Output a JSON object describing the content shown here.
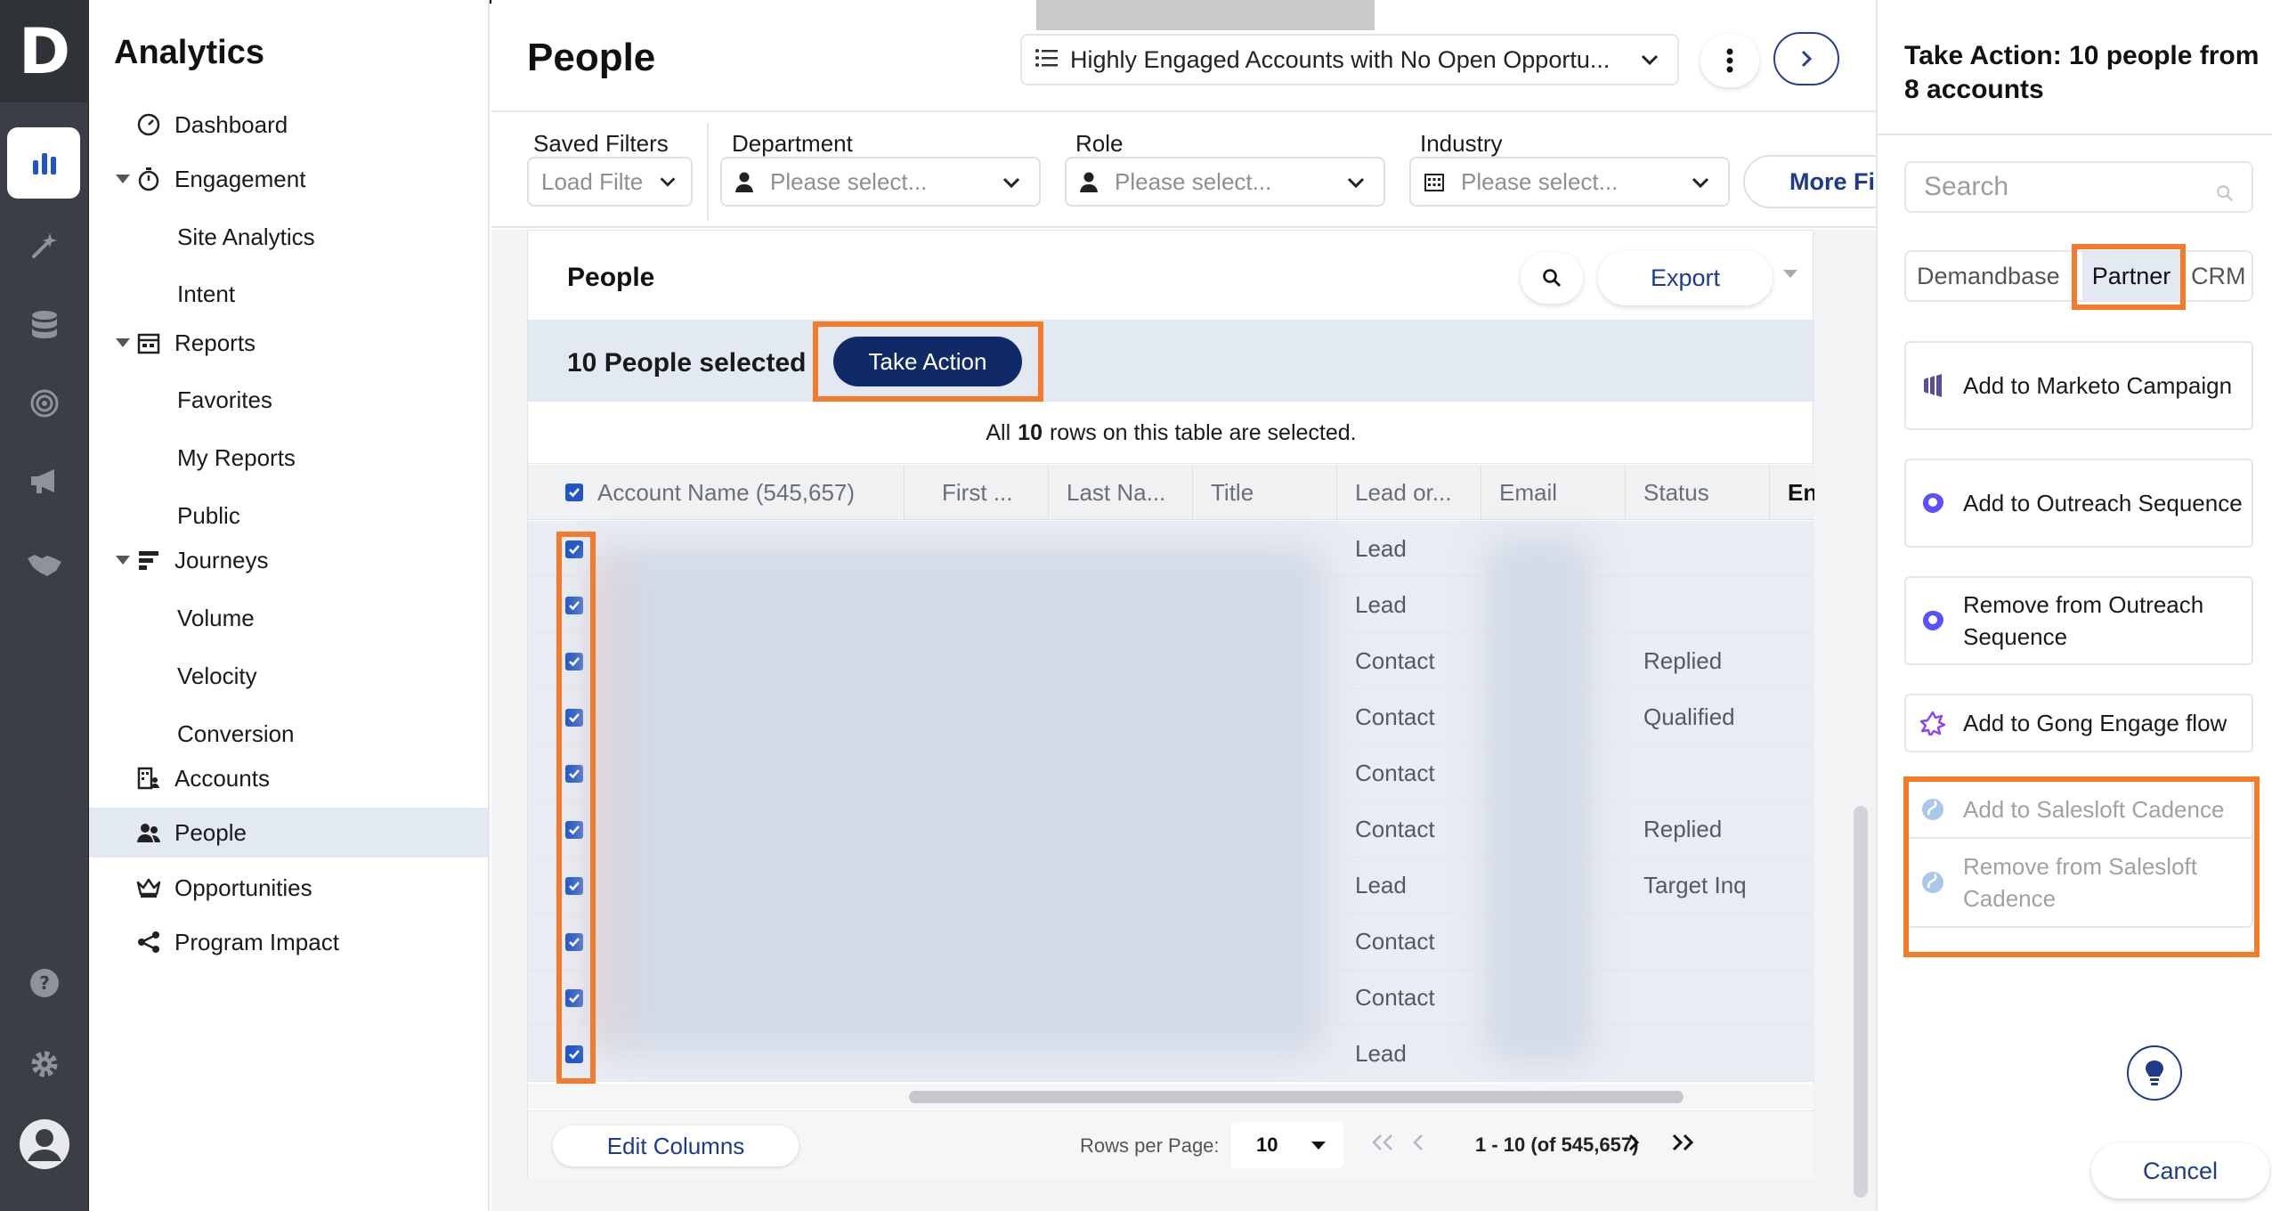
{
  "app": {
    "logo_letter": "D",
    "title": "Analytics"
  },
  "rail": {
    "icons": [
      "bar-chart-icon",
      "sparkle-wand-icon",
      "database-icon",
      "target-icon",
      "megaphone-icon",
      "handshake-icon",
      "help-icon",
      "gear-icon",
      "user-avatar-icon"
    ]
  },
  "nav": {
    "items": [
      {
        "label": "Dashboard",
        "icon": "gauge-icon"
      },
      {
        "label": "Engagement",
        "icon": "stopwatch-icon",
        "expanded": true
      },
      {
        "label": "Site Analytics"
      },
      {
        "label": "Intent"
      },
      {
        "label": "Reports",
        "icon": "calendar-report-icon",
        "expanded": true
      },
      {
        "label": "Favorites"
      },
      {
        "label": "My Reports"
      },
      {
        "label": "Public"
      },
      {
        "label": "Journeys",
        "icon": "journey-bars-icon",
        "expanded": true
      },
      {
        "label": "Volume"
      },
      {
        "label": "Velocity"
      },
      {
        "label": "Conversion"
      },
      {
        "label": "Accounts",
        "icon": "accounts-icon"
      },
      {
        "label": "People",
        "icon": "people-icon",
        "selected": true
      },
      {
        "label": "Opportunities",
        "icon": "crown-icon"
      },
      {
        "label": "Program Impact",
        "icon": "share-nodes-icon"
      }
    ]
  },
  "header": {
    "page_title": "People",
    "view": "Highly Engaged Accounts with No Open Opportu..."
  },
  "filters": {
    "saved_filters": {
      "label": "Saved Filters",
      "placeholder": "Load Filte"
    },
    "department": {
      "label": "Department",
      "placeholder": "Please select..."
    },
    "role": {
      "label": "Role",
      "placeholder": "Please select..."
    },
    "industry": {
      "label": "Industry",
      "placeholder": "Please select..."
    },
    "more_filters": "More Filters"
  },
  "table_card": {
    "title": "People",
    "export_label": "Export",
    "selection_text": "10 People selected",
    "take_action_label": "Take Action",
    "all_rows_prefix": "All",
    "all_rows_count": "10",
    "all_rows_suffix": "rows on this table are selected.",
    "columns": [
      "Account Name (545,657)",
      "First ...",
      "Last Na...",
      "Title",
      "Lead or...",
      "Email",
      "Status",
      "En"
    ],
    "rows": [
      {
        "lead_or_contact": "Lead",
        "status": ""
      },
      {
        "lead_or_contact": "Lead",
        "status": ""
      },
      {
        "lead_or_contact": "Contact",
        "status": "Replied"
      },
      {
        "lead_or_contact": "Contact",
        "status": "Qualified"
      },
      {
        "lead_or_contact": "Contact",
        "status": ""
      },
      {
        "lead_or_contact": "Contact",
        "status": "Replied"
      },
      {
        "lead_or_contact": "Lead",
        "status": "Target Inq"
      },
      {
        "lead_or_contact": "Contact",
        "status": ""
      },
      {
        "lead_or_contact": "Contact",
        "status": ""
      },
      {
        "lead_or_contact": "Lead",
        "status": ""
      }
    ],
    "footer": {
      "edit_columns": "Edit Columns",
      "rows_per_page_label": "Rows per Page:",
      "rows_per_page": "10",
      "range": "1 - 10 (of 545,657)"
    }
  },
  "panel": {
    "title": "Take Action: 10 people from 8 accounts",
    "search_placeholder": "Search",
    "tabs": [
      "Demandbase",
      "Partner",
      "CRM"
    ],
    "active_tab": "Partner",
    "actions": [
      {
        "label": "Add to Marketo Campaign",
        "icon": "marketo-icon",
        "enabled": true
      },
      {
        "label": "Add to Outreach Sequence",
        "icon": "outreach-icon",
        "enabled": true
      },
      {
        "label": "Remove from Outreach Sequence",
        "icon": "outreach-icon",
        "enabled": true
      },
      {
        "label": "Add to Gong Engage flow",
        "icon": "gong-icon",
        "enabled": true
      },
      {
        "label": "Add to Salesloft Cadence",
        "icon": "salesloft-icon",
        "enabled": false
      },
      {
        "label": "Remove from Salesloft Cadence",
        "icon": "salesloft-icon",
        "enabled": false
      }
    ],
    "cancel_label": "Cancel"
  },
  "colors": {
    "primary": "#0f2a66",
    "link": "#1f3a8a",
    "highlight": "#f37b2b",
    "selection_bg": "#e3e9f2",
    "rail_bg": "#3b3f45"
  }
}
